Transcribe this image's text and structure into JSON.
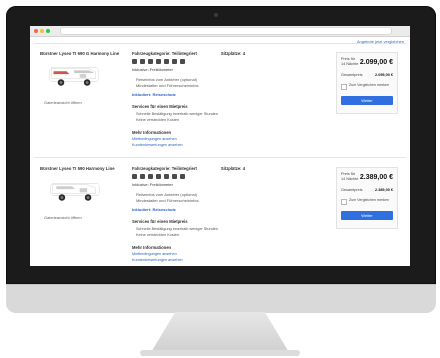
{
  "screen": {
    "top_link": "Angebote jetzt vergleichen",
    "listings": [
      {
        "title": "Bürstner Lyseo TI 690 G Harmony Line",
        "vehicle": "Fahrzeugkategorie: Teilintegriert",
        "seats": "Sitzplätze: 4",
        "included": "Inklusive: Freikilometer",
        "amenities": [
          {
            "icon": "bed-icon"
          },
          {
            "icon": "shower-icon"
          },
          {
            "icon": "kitchen-icon"
          },
          {
            "icon": "wc-icon"
          },
          {
            "icon": "heater-icon"
          },
          {
            "icon": "ac-icon"
          },
          {
            "icon": "bike-icon"
          }
        ],
        "rows": [
          "Reiseinfos vom Anbieter (optional)",
          "Mindestalter und Führerscheininfos"
        ],
        "badge": "Inkludiert: Reiseschutz",
        "services_title": "Services für einen Mietpreis",
        "services": [
          "Schnelle Bestätigung innerhalb weniger Stunden",
          "Keine versteckten Kosten"
        ],
        "links_title": "Mehr Informationen",
        "links": [
          "Mietbedingungen ansehen",
          "Kundenbewertungen ansehen"
        ],
        "gallery": "Galerieansicht öffnen",
        "price": {
          "label": "Preis für 14 Nächte",
          "value": "2.099,00 €",
          "row_label": "Gesamtpreis",
          "row_value": "2.099,00 €"
        },
        "checkbox_text": "Zum Vergleichen merken",
        "cta_label": "Weiter"
      },
      {
        "title": "Bürstner Lyseo TI 590 Harmony Line",
        "vehicle": "Fahrzeugkategorie: Teilintegriert",
        "seats": "Sitzplätze: 4",
        "included": "Inklusive: Freikilometer",
        "amenities": [
          {
            "icon": "bed-icon"
          },
          {
            "icon": "shower-icon"
          },
          {
            "icon": "kitchen-icon"
          },
          {
            "icon": "wc-icon"
          },
          {
            "icon": "heater-icon"
          },
          {
            "icon": "ac-icon"
          },
          {
            "icon": "bike-icon"
          }
        ],
        "rows": [
          "Reiseinfos vom Anbieter (optional)",
          "Mindestalter und Führerscheininfos"
        ],
        "badge": "Inkludiert: Reiseschutz",
        "services_title": "Services für einen Mietpreis",
        "services": [
          "Schnelle Bestätigung innerhalb weniger Stunden",
          "Keine versteckten Kosten"
        ],
        "links_title": "Mehr Informationen",
        "links": [
          "Mietbedingungen ansehen",
          "Kundenbewertungen ansehen"
        ],
        "gallery": "Galerieansicht öffnen",
        "price": {
          "label": "Preis für 14 Nächte",
          "value": "2.389,00 €",
          "row_label": "Gesamtpreis",
          "row_value": "2.389,00 €"
        },
        "checkbox_text": "Zum Vergleichen merken",
        "cta_label": "Weiter"
      }
    ]
  },
  "colors": {
    "accent": "#2f6fdf",
    "link": "#2b63c0",
    "bezel": "#1b1b1b"
  }
}
